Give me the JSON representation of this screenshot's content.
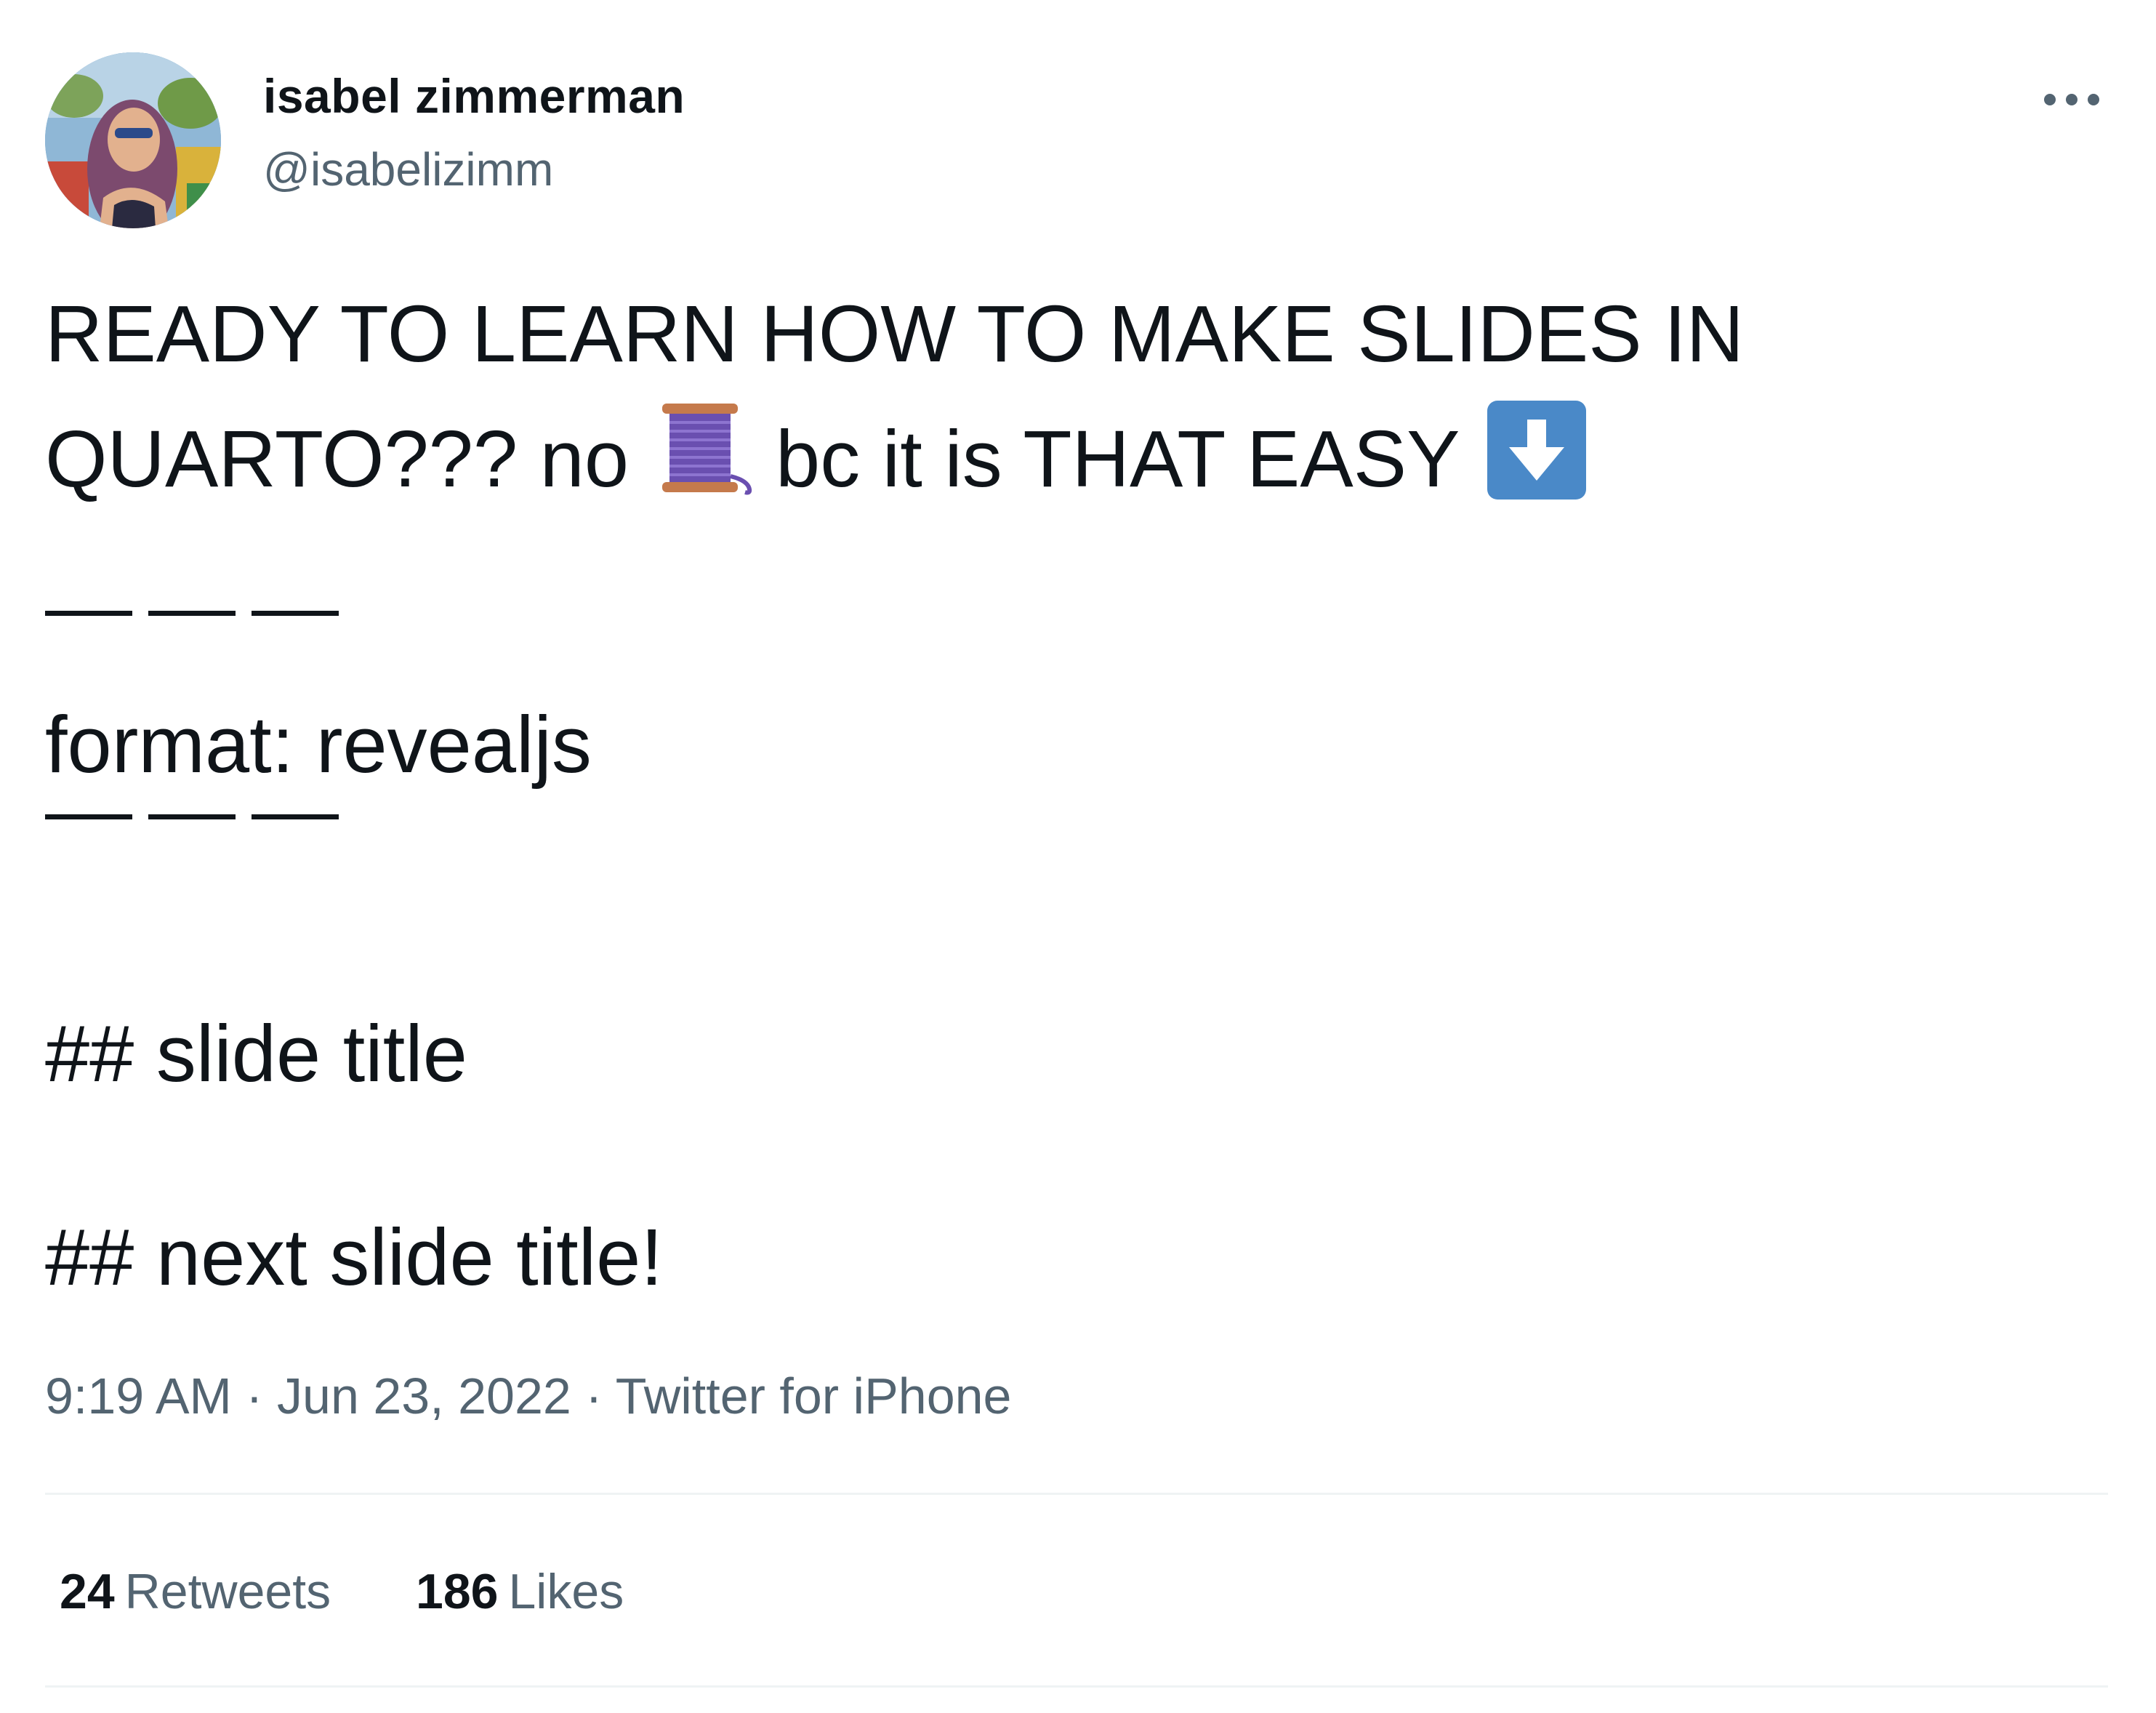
{
  "author": {
    "display_name": "isabel zimmerman",
    "handle": "@isabelizimm"
  },
  "tweet": {
    "line1": "READY TO LEARN HOW TO MAKE SLIDES IN",
    "line2_part1": "QUARTO??? no",
    "line2_part2": "bc it is THAT EASY",
    "emojis": [
      "thread-spool-icon",
      "down-arrow-button-icon"
    ],
    "format_line": "format: revealjs",
    "slide1": "## slide title",
    "slide2": "## next slide title!"
  },
  "meta": {
    "time": "9:19 AM",
    "date": "Jun 23, 2022",
    "separator": "·",
    "source": "Twitter for iPhone"
  },
  "stats": {
    "retweets_count": "24",
    "retweets_label": "Retweets",
    "likes_count": "186",
    "likes_label": "Likes"
  },
  "colors": {
    "text_primary": "#0f1419",
    "text_secondary": "#536471",
    "divider": "#eff3f4",
    "arrow_button": "#4a89c8",
    "spool_thread": "#6a4fb0",
    "spool_wood": "#c57a4c"
  }
}
